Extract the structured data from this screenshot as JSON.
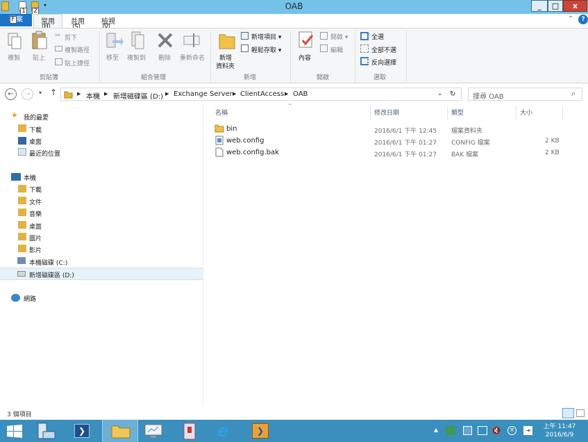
{
  "window": {
    "title": "OAB",
    "minimize": "_",
    "maximize": "□",
    "close": "x"
  },
  "keytips": {
    "qat1": "1",
    "qat2": "2",
    "file": "F",
    "home": "H",
    "share": "S",
    "view": "V"
  },
  "tabs": {
    "file": "檔案",
    "home": "常用",
    "share": "共用",
    "view": "檢視"
  },
  "ribbon": {
    "clipboard": {
      "label": "剪貼簿",
      "copy": "複製",
      "paste": "貼上",
      "cut": "剪下",
      "copy_path": "複製路徑",
      "paste_shortcut": "貼上捷徑"
    },
    "organize": {
      "label": "組合管理",
      "move_to": "移至",
      "copy_to": "複製到",
      "delete": "刪除",
      "rename": "重新命名"
    },
    "new": {
      "label": "新增",
      "new_folder_l1": "新增",
      "new_folder_l2": "資料夾",
      "new_item": "新增項目 ▾",
      "easy_access": "輕鬆存取 ▾"
    },
    "open": {
      "label": "開啟",
      "properties": "內容",
      "open": "開啟 ▾",
      "edit": "編輯"
    },
    "select": {
      "label": "選取",
      "select_all": "全選",
      "select_none": "全部不選",
      "invert": "反向選擇"
    }
  },
  "address": {
    "crumbs": [
      "本機",
      "新增磁碟區 (D:)",
      "Exchange Server",
      "ClientAccess",
      "OAB"
    ],
    "search_placeholder": "搜尋 OAB"
  },
  "nav": {
    "favorites": "我的最愛",
    "fav_items": [
      "下載",
      "桌面",
      "最近的位置"
    ],
    "this_pc": "本機",
    "pc_items": [
      "下載",
      "文件",
      "音樂",
      "桌面",
      "圖片",
      "影片",
      "本機磁碟 (C:)",
      "新增磁碟區 (D:)"
    ],
    "network": "網路"
  },
  "list": {
    "columns": [
      "名稱",
      "修改日期",
      "類型",
      "大小"
    ],
    "files": [
      {
        "name": "bin",
        "date": "2016/6/1 下午 12:45",
        "type": "檔案資料夾",
        "size": ""
      },
      {
        "name": "web.config",
        "date": "2016/6/1 下午 01:27",
        "type": "CONFIG 檔案",
        "size": "2 KB"
      },
      {
        "name": "web.config.bak",
        "date": "2016/6/1 下午 01:27",
        "type": "BAK 檔案",
        "size": "2 KB"
      }
    ]
  },
  "status": "3 個項目",
  "clock": {
    "time": "上午 11:47",
    "date": "2016/6/9"
  },
  "colors": {
    "titlebar": "#75c2e8",
    "taskbar": "#3a8fbe",
    "file_tab": "#1a74c8",
    "close": "#c7463b"
  }
}
